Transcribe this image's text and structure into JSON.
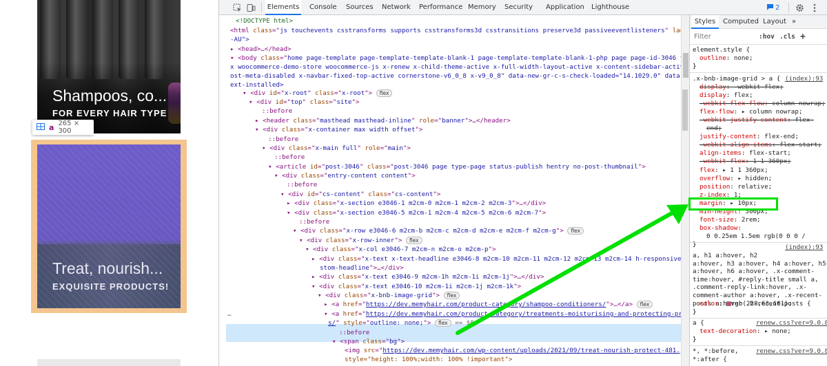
{
  "site": {
    "card1": {
      "title": "Shampoos, co...",
      "subtitle": "FOR EVERY HAIR TYPE"
    },
    "tooltip": {
      "tag": "a",
      "dims": "265 × 300"
    },
    "card2": {
      "title": "Treat, nourish...",
      "subtitle": "EXQUISITE PRODUCTS!"
    }
  },
  "devtools": {
    "tabs": [
      "Elements",
      "Console",
      "Sources",
      "Network",
      "Performance",
      "Memory",
      "Security",
      "Application",
      "Lighthouse"
    ],
    "active_tab": "Elements",
    "issues_count": "2",
    "dom": {
      "doctype": "<!DOCTYPE html>",
      "html_class": "js touchevents csstransforms supports csstransforms3d csstransitions preserve3d passiveeventlisteners",
      "html_lang": "en",
      "html_lang_cont": "-AU\">",
      "head": "<head>…</head>",
      "body_class_1": "home page-template page-template-template-blank-1 page-template-template-blank-1-php page page-id-3046 theme-",
      "body_class_2": "x woocommerce-demo-store woocommerce-js x-renew x-child-theme-active x-full-width-layout-active x-content-sidebar-active x-p",
      "body_class_3": "ost-meta-disabled x-navbar-fixed-top-active cornerstone-v6_0_8 x-v9_0_8\" data-new-gr-c-s-check-loaded=\"14.1029.0\" data-gr-",
      "body_class_4": "ext-installed>",
      "x_root": "x-root",
      "top": "top",
      "site": "site",
      "before": "::before",
      "header_class": "masthead masthead-inline",
      "header_role": "banner",
      "container_class": "x-container max width offset",
      "main_class": "x-main full",
      "main_role": "main",
      "article_id": "post-3046",
      "article_class": "post-3046 page type-page status-publish hentry no-post-thumbnail",
      "entry_content": "entry-content content",
      "cs_id": "cs-content",
      "cs_class": "cs-content",
      "section1": "x-section e3046-1 m2cm-0 m2cm-1 m2cm-2 m2cm-3",
      "section2": "x-section e3046-5 m2cm-1 m2cm-4 m2cm-5 m2cm-6 m2cm-7",
      "row": "x-row e3046-6 m2cm-b m2cm-c m2cm-d m2cm-e m2cm-f m2cm-g",
      "row_inner": "x-row-inner",
      "col": "x-col e3046-7 m2cm-n m2cm-o m2cm-p",
      "text1_a": "x-text x-text-headline e3046-8 m2cm-10 m2cm-11 m2cm-12 m2cm-13 m2cm-14 h-responsive h-cu",
      "text1_b": "stom-headline",
      "text2": "x-text e3046-9 m2cm-1h m2cm-1i m2cm-1j",
      "text3": "x-text e3046-10 m2cm-1i m2cm-1j m2cm-1k",
      "grid": "x-bnb-image-grid",
      "href1": "https://dev.memyhair.com/product-category/shampoo-conditioners/",
      "href2a": "https://dev.memyhair.com/product-category/treatments-moisturising-and-protecting-product",
      "href2b": "s/",
      "style_outline": "outline: none;",
      "eq": "== $0",
      "span_bg": "bg",
      "img_src": "https://dev.memyhair.com/wp-content/uploads/2021/09/treat-nourish-protect-481.jpg",
      "img_style": "style=\"height: 100%;width: 100% !important\">",
      "flex": "flex",
      "ellipsis": "…"
    },
    "styles": {
      "tabs": [
        "Styles",
        "Computed",
        "Layout",
        "»"
      ],
      "filter_placeholder": "Filter",
      "tools": [
        ":hov",
        ".cls",
        "+"
      ],
      "element_style": "element.style {",
      "element_style_prop": "outline",
      "element_style_val": "none;",
      "rule1_selector": ".x-bnb-image-grid > a {",
      "rule1_source": "(index):93",
      "rule1": [
        {
          "p": "display",
          "v": "-webkit-flex;",
          "struck": true
        },
        {
          "p": "display",
          "v": "flex;",
          "struck": false
        },
        {
          "p": "-webkit-flex-flow",
          "v": "column nowrap;",
          "struck": true
        },
        {
          "p": "flex-flow",
          "v": "▸ column nowrap;",
          "struck": false
        },
        {
          "p": "-webkit-justify-content",
          "v": "flex-",
          "struck": true
        },
        {
          "p": "",
          "v": "end;",
          "struck": true
        },
        {
          "p": "justify-content",
          "v": "flex-end;",
          "struck": false
        },
        {
          "p": "-webkit-align-items",
          "v": "flex-start;",
          "struck": true
        },
        {
          "p": "align-items",
          "v": "flex-start;",
          "struck": false
        },
        {
          "p": "-webkit-flex",
          "v": "1 1 360px;",
          "struck": true
        },
        {
          "p": "flex",
          "v": "▸ 1 1 360px;",
          "struck": false
        },
        {
          "p": "overflow",
          "v": "▸ hidden;",
          "struck": false
        },
        {
          "p": "position",
          "v": "relative;",
          "struck": false
        },
        {
          "p": "z-index",
          "v": "1;",
          "struck": false
        },
        {
          "p": "margin",
          "v": "▸ 10px;",
          "struck": false
        },
        {
          "p": "min-height",
          "v": "300px;",
          "struck": false
        },
        {
          "p": "font-size",
          "v": "2rem;",
          "struck": false
        },
        {
          "p": "box-shadow",
          "v": "",
          "struck": false
        },
        {
          "p": "",
          "v": "0 0.25em 1.5em rgb(0 0 0 /",
          "struck": false
        }
      ],
      "rule2_selector": "a, h1 a:hover, h2 a:hover, h3 a:hover, h4 a:hover, h5 a:hover, h6 a:hover, .x-comment-time:hover, #reply-title small a, .comment-reply-link:hover, .x-comment-author a:hover, .x-recent-posts a:hover .h-recent-posts {",
      "rule2_lines": [
        "a, h1 a:hover, h2",
        "a:hover, h3 a:hover, h4 a:hover, h5",
        "a:hover, h6 a:hover, .x-comment-",
        "time:hover, #reply-title small a,",
        ".comment-reply-link:hover, .x-",
        "comment-author a:hover, .x-recent-",
        "posts a:hover .h-recent-posts {"
      ],
      "rule2_source": "(index):93",
      "rule2_prop": "color",
      "rule2_val": "rgb(228,63,101);",
      "rule2_color": "#e43f65",
      "rule3_selector": "a {",
      "rule3_source": "renew.css?ver=9.0.8:1",
      "rule3_prop": "text-decoration",
      "rule3_val": "▸ none;",
      "rule4_selector": "*, *:before,",
      "rule4_selector2": "*:after {",
      "rule4_source": "renew.css?ver=9.0.8:1",
      "close": "}"
    },
    "highlight_color": "#00e000"
  }
}
